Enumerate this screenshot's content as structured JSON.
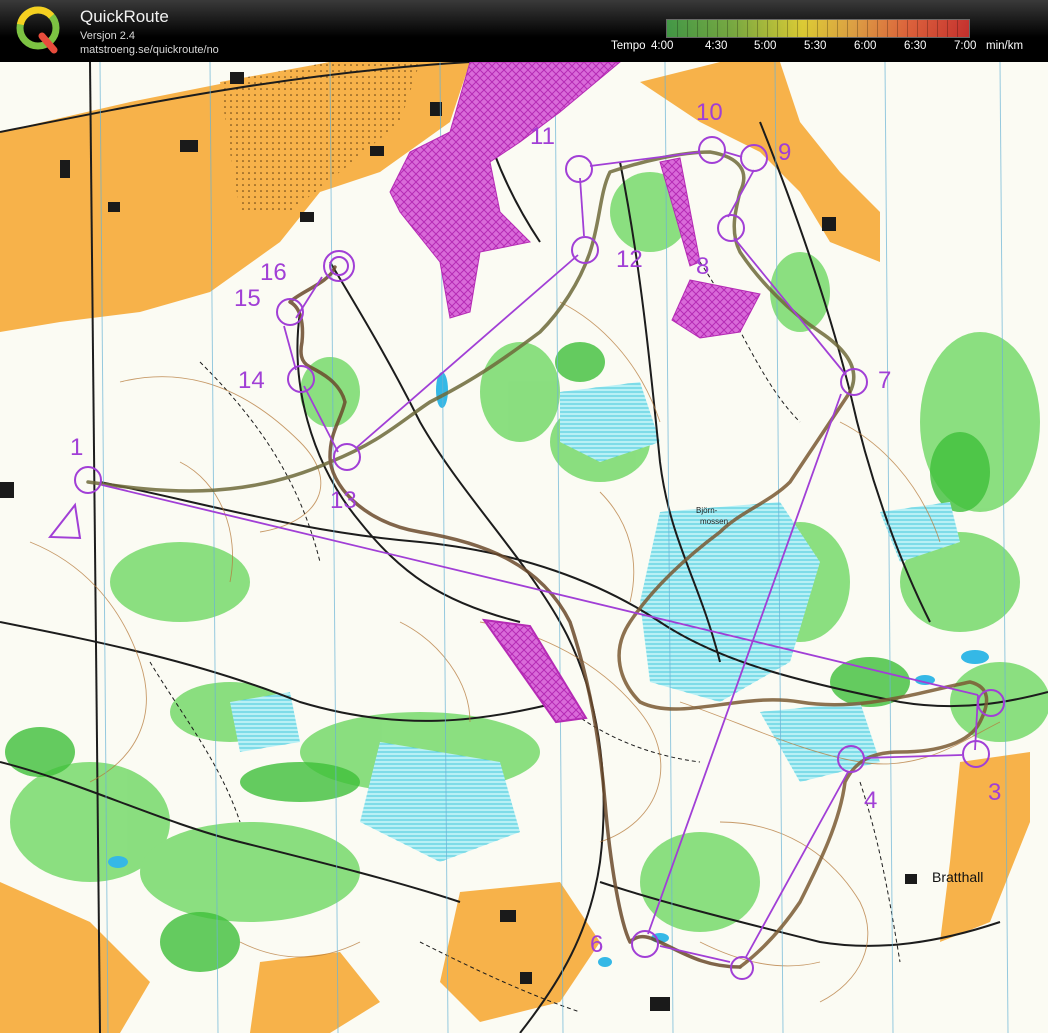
{
  "header": {
    "app_title": "QuickRoute",
    "version": "Versjon 2.4",
    "url": "matstroeng.se/quickroute/no",
    "pace_scale": {
      "prefix": "Tempo",
      "ticks": [
        "4:00",
        "4:30",
        "5:00",
        "5:30",
        "6:00",
        "6:30",
        "7:00"
      ],
      "unit": "min/km"
    }
  },
  "map": {
    "place_names": {
      "bratthall": "Bratthall",
      "bjornmossen_1": "Björn-",
      "bjornmossen_2": "mossen"
    },
    "controls": [
      "1",
      "3",
      "4",
      "6",
      "7",
      "8",
      "9",
      "10",
      "11",
      "12",
      "13",
      "14",
      "15",
      "16"
    ],
    "colors": {
      "course": "#a13fd6",
      "route": "#6b4a2c",
      "open_land": "#f7b24a",
      "forest_green": "#6fd36a",
      "marsh_blue": "#7fdde8",
      "out_of_bounds": "#cc33cc"
    }
  }
}
